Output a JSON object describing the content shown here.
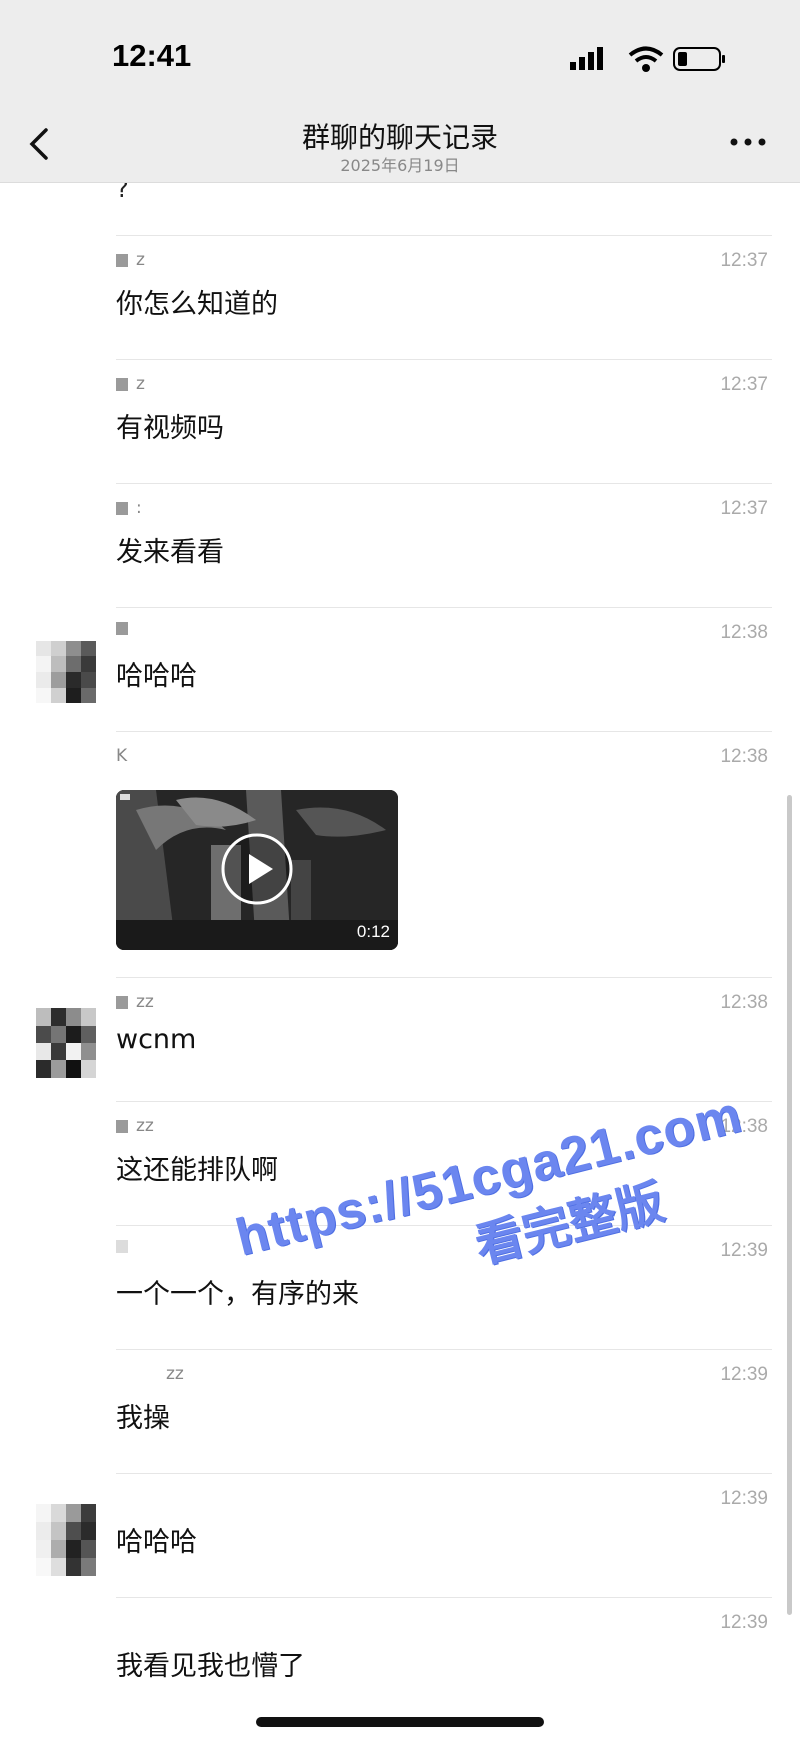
{
  "status_bar": {
    "time": "12:41"
  },
  "nav": {
    "title": "群聊的聊天记录",
    "subtitle": "2025年6月19日"
  },
  "chat": {
    "top_fragment": "?",
    "messages": [
      {
        "sender": "z",
        "time": "12:37",
        "text": "你怎么知道的"
      },
      {
        "sender": "z",
        "time": "12:37",
        "text": "有视频吗"
      },
      {
        "sender": ":",
        "time": "12:37",
        "text": "发来看看"
      },
      {
        "sender": "",
        "time": "12:38",
        "text": "哈哈哈"
      },
      {
        "sender": "K",
        "time": "12:38",
        "video_duration": "0:12"
      },
      {
        "sender": "zz",
        "time": "12:38",
        "text": "wcnm"
      },
      {
        "sender": "zz",
        "time": "12:38",
        "text": "这还能排队啊"
      },
      {
        "sender": "",
        "time": "12:39",
        "text": "一个一个，有序的来"
      },
      {
        "sender": "zz",
        "time": "12:39",
        "text": "我操"
      },
      {
        "sender": "",
        "time": "12:39",
        "text": "哈哈哈"
      },
      {
        "sender": "",
        "time": "12:39",
        "text": "我看见我也懵了"
      }
    ]
  },
  "watermark": {
    "url": "https://51cga21.com",
    "text": "看完整版"
  },
  "colors": {
    "watermark": "#6b86ef",
    "nav_bg": "#ededed"
  }
}
